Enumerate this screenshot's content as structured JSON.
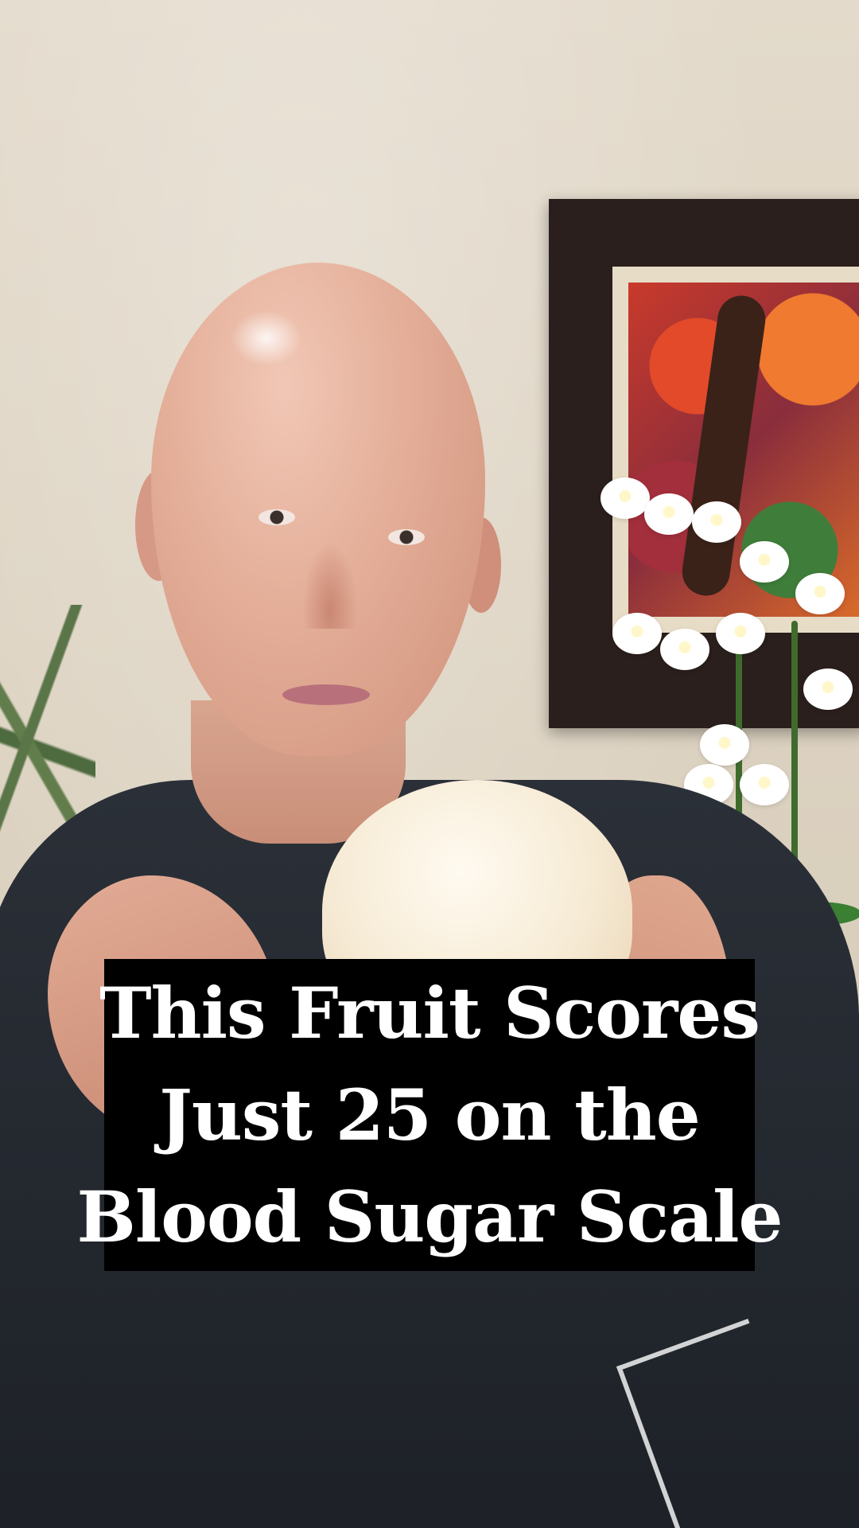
{
  "caption": {
    "lines": [
      "This Fruit Scores",
      "Just 25 on the",
      "Blood Sugar Scale"
    ],
    "background_color": "#000000",
    "text_color": "#ffffff"
  }
}
